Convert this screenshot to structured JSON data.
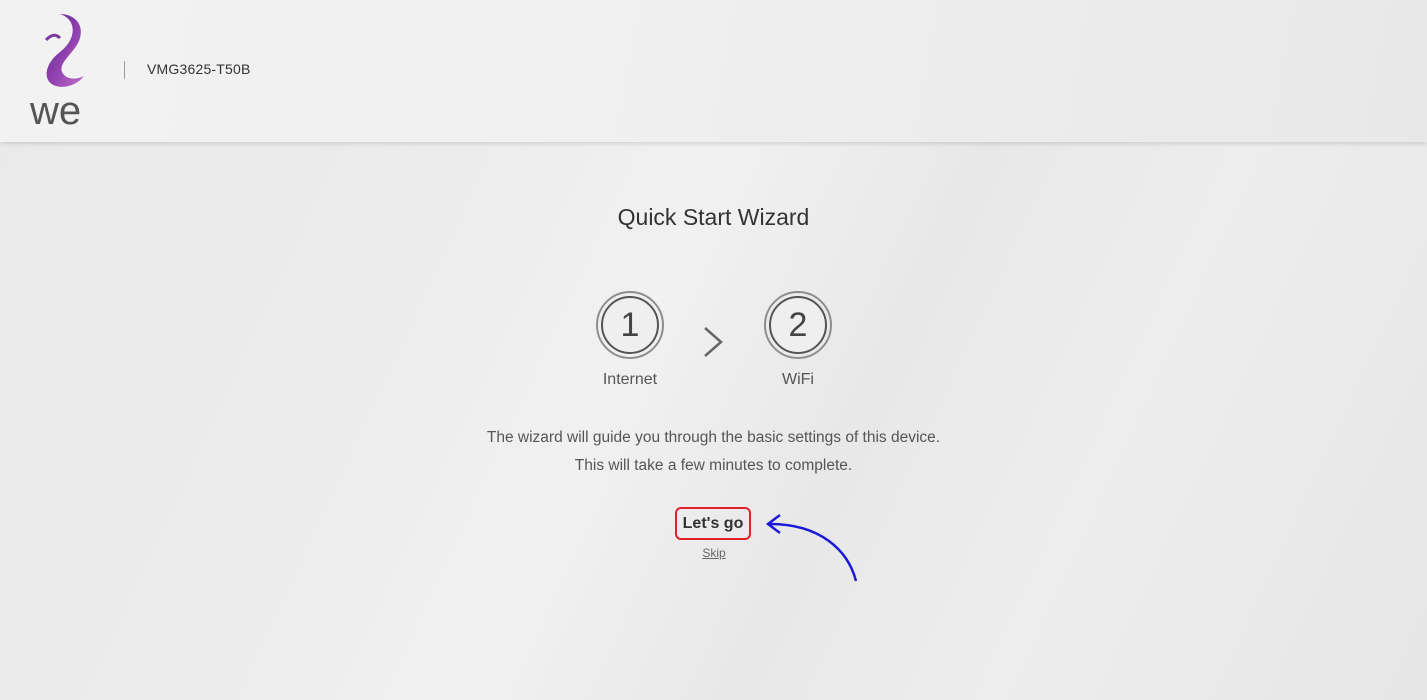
{
  "header": {
    "logo_text": "we",
    "model": "VMG3625-T50B"
  },
  "wizard": {
    "title": "Quick Start Wizard",
    "steps": [
      {
        "number": "1",
        "label": "Internet"
      },
      {
        "number": "2",
        "label": "WiFi"
      }
    ],
    "separator_icon": "chevron-right-icon",
    "description_line1": "The wizard will guide you through the basic settings of this device.",
    "description_line2": "This will take a few minutes to complete.",
    "primary_button": "Let's go",
    "skip_link": "Skip"
  },
  "annotation": {
    "highlight_color": "#e0202a",
    "arrow_color": "#1a1ad6"
  }
}
